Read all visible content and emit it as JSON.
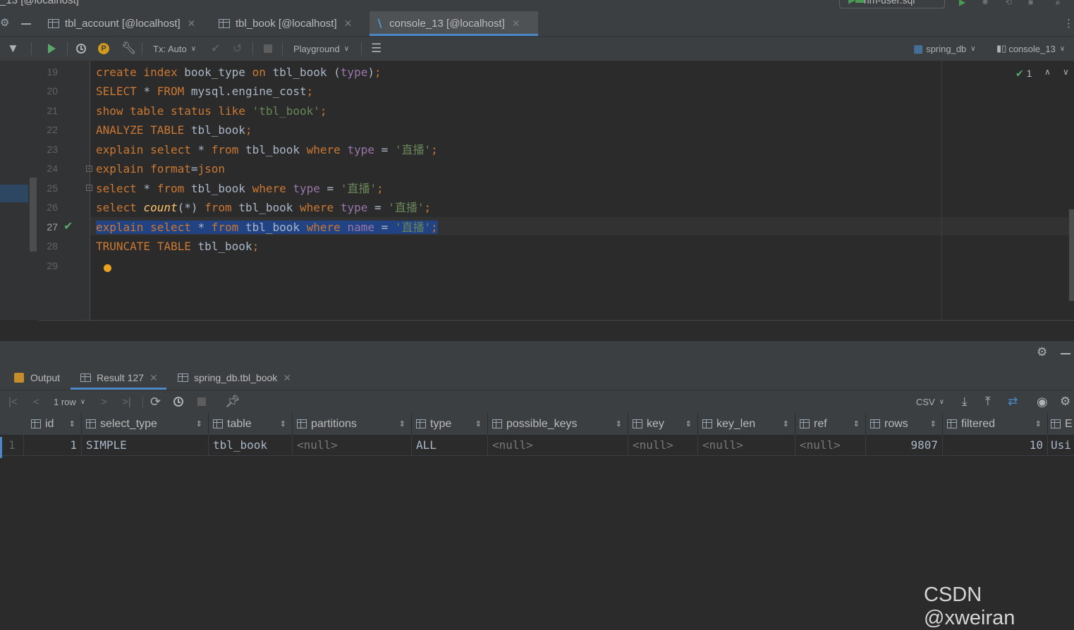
{
  "window": {
    "title": "_13 [@localhost]",
    "run_config": "rim-user.sql"
  },
  "editor_tabs": [
    {
      "label": "tbl_account [@localhost]",
      "active": false
    },
    {
      "label": "tbl_book [@localhost]",
      "active": false
    },
    {
      "label": "console_13 [@localhost]",
      "active": true
    }
  ],
  "toolbar": {
    "tx_mode": "Tx: Auto",
    "playground": "Playground",
    "datasource": "spring_db",
    "session": "console_13"
  },
  "inspection": {
    "count": "1"
  },
  "editor": {
    "current_line": 27,
    "lines": [
      {
        "n": "19",
        "text": "create index book_type on tbl_book (type);"
      },
      {
        "n": "20",
        "text": "SELECT * FROM mysql.engine_cost;"
      },
      {
        "n": "21",
        "text": "show table status like 'tbl_book';"
      },
      {
        "n": "22",
        "text": "ANALYZE TABLE tbl_book;"
      },
      {
        "n": "23",
        "text": "explain select * from tbl_book where type = '直播';"
      },
      {
        "n": "24",
        "text": "explain format=json"
      },
      {
        "n": "25",
        "text": "select * from tbl_book where type = '直播';"
      },
      {
        "n": "26",
        "text": "select count(*) from tbl_book where type = '直播';"
      },
      {
        "n": "27",
        "text": "explain select * from tbl_book where name = '直播';"
      },
      {
        "n": "28",
        "text": "TRUNCATE TABLE tbl_book;"
      },
      {
        "n": "29",
        "text": ""
      }
    ]
  },
  "result_tabs": [
    {
      "label": "Output",
      "active": false
    },
    {
      "label": "Result 127",
      "active": true
    },
    {
      "label": "spring_db.tbl_book",
      "active": false
    }
  ],
  "result_toolbar": {
    "row_count": "1 row",
    "export_format": "CSV"
  },
  "grid": {
    "columns": [
      "id",
      "select_type",
      "table",
      "partitions",
      "type",
      "possible_keys",
      "key",
      "key_len",
      "ref",
      "rows",
      "filtered",
      "E"
    ],
    "rows": [
      {
        "rownum": "1",
        "cells": [
          "1",
          "SIMPLE",
          "tbl_book",
          "<null>",
          "ALL",
          "<null>",
          "<null>",
          "<null>",
          "<null>",
          "9807",
          "10",
          "Usi"
        ]
      }
    ]
  },
  "watermark": "CSDN @xweiran",
  "colors": {
    "accent": "#4a88c7",
    "keyword": "#cc7832",
    "string": "#6a8759",
    "selection": "#214283"
  }
}
